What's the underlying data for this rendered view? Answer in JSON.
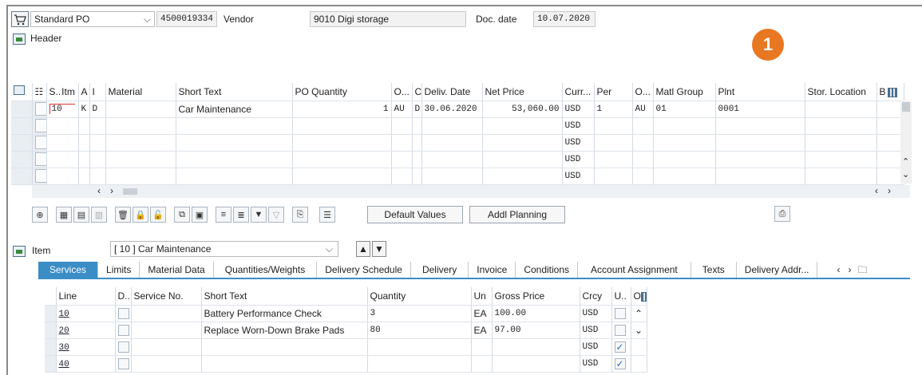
{
  "header_bar": {
    "doc_type": "Standard PO",
    "po_number": "4500019334",
    "vendor_label": "Vendor",
    "vendor_value": "9010 Digi storage",
    "doc_date_label": "Doc. date",
    "doc_date_value": "10.07.2020",
    "header_label": "Header"
  },
  "badge": "1",
  "item_table": {
    "columns": [
      "S..",
      "Itm",
      "A",
      "I",
      "Material",
      "Short Text",
      "PO Quantity",
      "O...",
      "C",
      "Deliv. Date",
      "Net Price",
      "Curr...",
      "Per",
      "O...",
      "Matl Group",
      "Plnt",
      "Stor. Location",
      "B"
    ],
    "rows": [
      {
        "itm": "10",
        "a": "K",
        "i": "D",
        "material": "",
        "short_text": "Car Maintenance",
        "po_qty": "1",
        "ou": "AU",
        "c": "D",
        "deliv": "30.06.2020",
        "net_price": "53,060.00",
        "curr": "USD",
        "per": "1",
        "ou2": "AU",
        "matl_group": "01",
        "plnt": "0001"
      },
      {
        "curr": "USD"
      },
      {
        "curr": "USD"
      },
      {
        "curr": "USD"
      },
      {
        "curr": "USD"
      }
    ]
  },
  "buttons": {
    "default_values": "Default Values",
    "addl_planning": "Addl Planning"
  },
  "item_bar": {
    "label": "Item",
    "selected": "[ 10 ] Car Maintenance"
  },
  "tabs": [
    "Services",
    "Limits",
    "Material Data",
    "Quantities/Weights",
    "Delivery Schedule",
    "Delivery",
    "Invoice",
    "Conditions",
    "Account Assignment",
    "Texts",
    "Delivery Addr..."
  ],
  "services_table": {
    "columns": [
      "Line",
      "D..",
      "Service No.",
      "Short Text",
      "Quantity",
      "Un",
      "Gross Price",
      "Crcy",
      "U..",
      "O"
    ],
    "rows": [
      {
        "line": "10",
        "short_text": "Battery Performance Check",
        "quantity": "3",
        "un": "EA",
        "gross_price": "100.00",
        "crcy": "USD",
        "checked": false
      },
      {
        "line": "20",
        "short_text": "Replace Worn-Down Brake Pads",
        "quantity": "80",
        "un": "EA",
        "gross_price": "97.00",
        "crcy": "USD",
        "checked": false
      },
      {
        "line": "30",
        "short_text": "",
        "quantity": "",
        "un": "",
        "gross_price": "",
        "crcy": "USD",
        "checked": true
      },
      {
        "line": "40",
        "short_text": "",
        "quantity": "",
        "un": "",
        "gross_price": "",
        "crcy": "USD",
        "checked": true
      }
    ]
  },
  "colors": {
    "accent": "#3b8dc6",
    "badge": "#e87722",
    "check": "#2a6db5"
  }
}
